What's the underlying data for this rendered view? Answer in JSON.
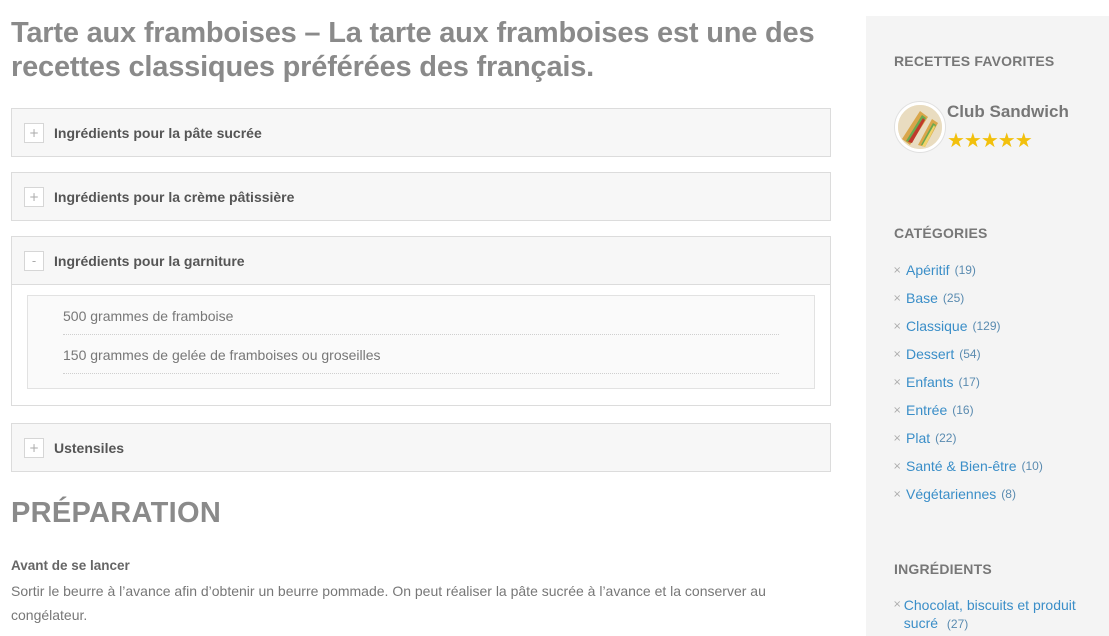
{
  "recipe": {
    "title": "Tarte aux framboises – La tarte aux framboises est une des recettes classiques préférées des français."
  },
  "sections": [
    {
      "label": "Ingrédients pour la pâte sucrée",
      "toggle": "+",
      "expanded": false
    },
    {
      "label": "Ingrédients pour la crème pâtissière",
      "toggle": "+",
      "expanded": false
    },
    {
      "label": "Ingrédients pour la garniture",
      "toggle": "-",
      "expanded": true,
      "items": [
        "500 grammes de framboise",
        "150 grammes de gelée de framboises ou groseilles"
      ]
    },
    {
      "label": "Ustensiles",
      "toggle": "+",
      "expanded": false
    }
  ],
  "preparation": {
    "heading": "PRÉPARATION",
    "subheading": "Avant de se lancer",
    "text": "Sortir le beurre à l’avance afin d’obtenir un beurre pommade. On peut réaliser la pâte sucrée à l’avance et la conserver au congélateur."
  },
  "sidebar": {
    "favorites_heading": "RECETTES FAVORITES",
    "favorite": {
      "name": "Club Sandwich",
      "rating": 5,
      "stars": "★★★★★"
    },
    "categories_heading": "CATÉGORIES",
    "categories": [
      {
        "name": "Apéritif",
        "count": "(19)"
      },
      {
        "name": "Base",
        "count": "(25)"
      },
      {
        "name": "Classique",
        "count": "(129)"
      },
      {
        "name": "Dessert",
        "count": "(54)"
      },
      {
        "name": "Enfants",
        "count": "(17)"
      },
      {
        "name": "Entrée",
        "count": "(16)"
      },
      {
        "name": "Plat",
        "count": "(22)"
      },
      {
        "name": "Santé & Bien-être",
        "count": "(10)"
      },
      {
        "name": "Végétariennes",
        "count": "(8)"
      }
    ],
    "ingredients_heading": "INGRÉDIENTS",
    "ingredients": [
      {
        "name": "Chocolat, biscuits et produit sucré",
        "count": "(27)"
      }
    ],
    "bullet": "×"
  },
  "colors": {
    "link": "#3a8ec8",
    "star": "#f2c00c",
    "heading": "#8a8a8a"
  }
}
